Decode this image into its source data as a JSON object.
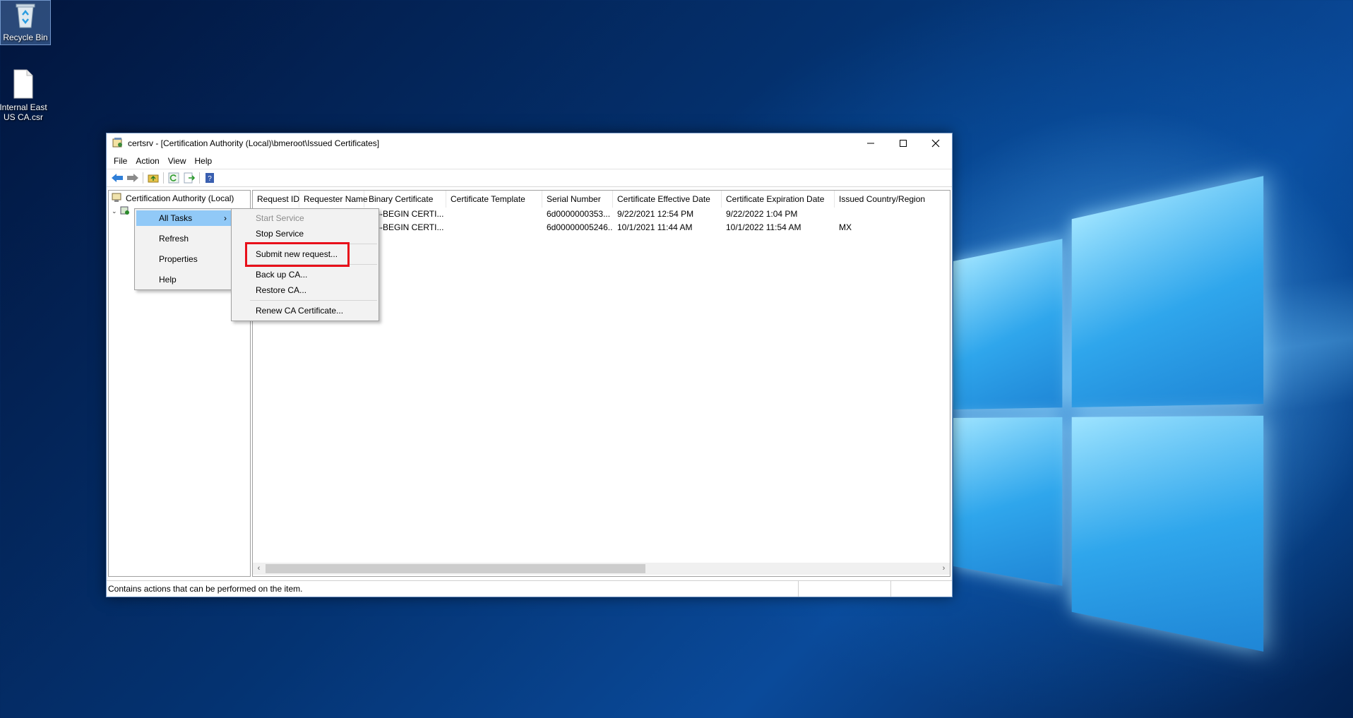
{
  "desktop": {
    "icons": [
      {
        "label": "Recycle Bin"
      },
      {
        "label": "Internal East US CA.csr"
      }
    ]
  },
  "window": {
    "title": "certsrv - [Certification Authority (Local)\\bmeroot\\Issued Certificates]",
    "menu": [
      "File",
      "Action",
      "View",
      "Help"
    ],
    "tree": {
      "root": "Certification Authority (Local)"
    },
    "columns": [
      "Request ID",
      "Requester Name",
      "Binary Certificate",
      "Certificate Template",
      "Serial Number",
      "Certificate Effective Date",
      "Certificate Expiration Date",
      "Issued Country/Region"
    ],
    "rows": [
      {
        "requester_suffix": "...",
        "binary": "-----BEGIN CERTI...",
        "template": "",
        "serial": "6d0000000353...",
        "effective": "9/22/2021 12:54 PM",
        "expiration": "9/22/2022 1:04 PM",
        "country": ""
      },
      {
        "requester_suffix": "...",
        "binary": "-----BEGIN CERTI...",
        "template": "",
        "serial": "6d00000005246...",
        "effective": "10/1/2021 11:44 AM",
        "expiration": "10/1/2022 11:54 AM",
        "country": "MX"
      }
    ],
    "status": "Contains actions that can be performed on the item."
  },
  "context_menu": {
    "items": [
      "All Tasks",
      "Refresh",
      "Properties",
      "Help"
    ],
    "submenu_arrow": "›"
  },
  "submenu": {
    "items": [
      "Start Service",
      "Stop Service",
      "Submit new request...",
      "Back up CA...",
      "Restore CA...",
      "Renew CA Certificate..."
    ]
  },
  "colors": {
    "highlight_box": "#e8101a",
    "menu_active": "#91c9f7"
  }
}
